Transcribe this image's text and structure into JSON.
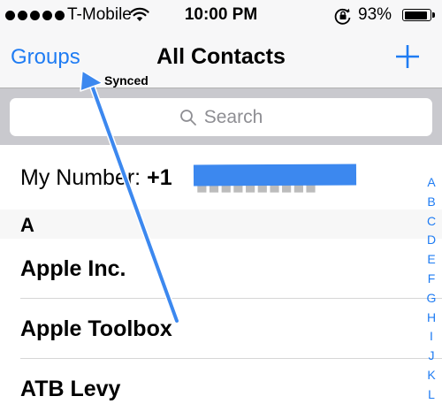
{
  "status_bar": {
    "carrier": "T-Mobile",
    "time": "10:00 PM",
    "battery_percent": "93%",
    "battery_level": 0.93,
    "signal_bars": 5
  },
  "nav": {
    "groups_label": "Groups",
    "title": "All Contacts",
    "add_label": "+",
    "annotation": "Synced"
  },
  "search": {
    "placeholder": "Search"
  },
  "my_number": {
    "label": "My Number:",
    "prefix": "+1"
  },
  "sections": [
    {
      "letter": "A",
      "contacts": [
        "Apple Inc.",
        "Apple Toolbox",
        "ATB Levy"
      ]
    }
  ],
  "index": [
    "A",
    "B",
    "C",
    "D",
    "E",
    "F",
    "G",
    "H",
    "I",
    "J",
    "K",
    "L"
  ],
  "colors": {
    "accent": "#1f7cf3",
    "annotation": "#3c88ef"
  }
}
